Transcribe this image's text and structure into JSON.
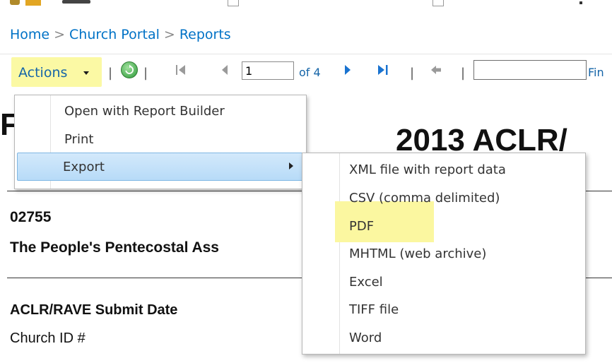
{
  "breadcrumb": {
    "items": [
      "Home",
      "Church Portal",
      "Reports"
    ],
    "separator": ">"
  },
  "toolbar": {
    "actions_label": "Actions",
    "separator": "|",
    "page_value": "1",
    "page_of": "of 4",
    "find_value": "",
    "find_label": "Fin"
  },
  "actions_menu": {
    "items": [
      "Open with Report Builder",
      "Print",
      "Export"
    ]
  },
  "export_menu": {
    "items": [
      "XML file with report data",
      "CSV (comma delimited)",
      "PDF",
      "MHTML (web archive)",
      "Excel",
      "TIFF file",
      "Word"
    ]
  },
  "report": {
    "title_partial": "2013 ACLR/",
    "left_letter": "F",
    "church_number": "02755",
    "church_name": "The People's Pentecostal Ass",
    "submit_date_label": "ACLR/RAVE Submit Date",
    "church_id_label": "Church ID #"
  },
  "colors": {
    "link_blue": "#0072c6",
    "highlight_yellow": "#fbf9a4",
    "menu_hover_blue": "#c5e1f9"
  },
  "icons": {
    "refresh": "refresh-icon",
    "first_page": "first-page-icon",
    "prev_page": "prev-page-icon",
    "next_page": "next-page-icon",
    "last_page": "last-page-icon",
    "back": "back-icon"
  }
}
